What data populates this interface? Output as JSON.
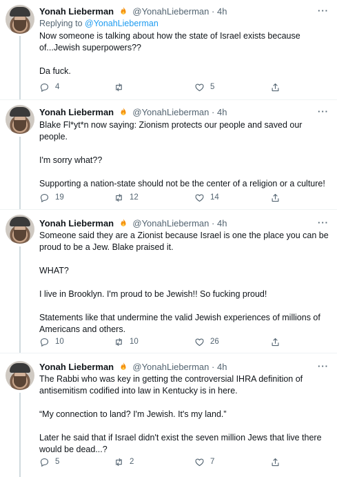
{
  "tweets": [
    {
      "name": "Yonah Lieberman",
      "handle": "@YonahLieberman",
      "time": "· 4h",
      "replying_prefix": "Replying to ",
      "replying_to": "@YonahLieberman",
      "text": "Now someone is talking about how the state of Israel exists because of...Jewish superpowers??\n\nDa fuck.",
      "replies": "4",
      "retweets": "",
      "likes": "5"
    },
    {
      "name": "Yonah Lieberman",
      "handle": "@YonahLieberman",
      "time": "· 4h",
      "text": "Blake Fl*yt*n now saying: Zionism protects our people and saved our people.\n\nI'm sorry what??\n\nSupporting a nation-state should not be the center of a religion or a culture!",
      "replies": "19",
      "retweets": "12",
      "likes": "14"
    },
    {
      "name": "Yonah Lieberman",
      "handle": "@YonahLieberman",
      "time": "· 4h",
      "text": "Someone said they are a Zionist because Israel is one the place you can be proud to be a Jew. Blake praised it.\n\nWHAT?\n\nI live in Brooklyn. I'm proud to be Jewish!! So fucking proud!\n\nStatements like that undermine the valid Jewish experiences of millions of Americans and others.",
      "replies": "10",
      "retweets": "10",
      "likes": "26"
    },
    {
      "name": "Yonah Lieberman",
      "handle": "@YonahLieberman",
      "time": "· 4h",
      "text": "The Rabbi who was key in getting the controversial IHRA definition of antisemitism codified into law in Kentucky is in here.\n\n“My connection to land? I'm Jewish. It's my land.”\n\nLater he said that if Israel didn't exist the seven million Jews that live there would be dead...?",
      "replies": "5",
      "retweets": "2",
      "likes": "7"
    }
  ],
  "more_label": "···",
  "colors": {
    "accent": "#1d9bf0",
    "muted": "#536471",
    "text": "#0f1419",
    "fire": "#f4900c"
  },
  "icons": {
    "reply": "reply-icon",
    "retweet": "retweet-icon",
    "like": "heart-icon",
    "share": "share-icon",
    "more": "more-icon",
    "badge": "fire-emoji-icon"
  }
}
